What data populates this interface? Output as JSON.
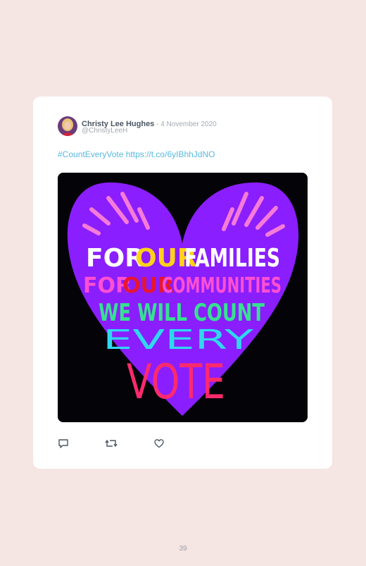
{
  "tweet": {
    "author_name": "Christy Lee Hughes",
    "separator": " - ",
    "date": "4 November 2020",
    "handle": "@ChristyLeeH",
    "hashtag": "#CountEveryVote",
    "link": "https://t.co/6yIBhhJdNO",
    "image": {
      "line1": [
        "FOR",
        "OUR",
        "FAMILIES"
      ],
      "line2": [
        "FOR",
        "OUR",
        "COMMUNITIES"
      ],
      "line3": "WE WILL COUNT",
      "line4": "EVERY",
      "line5": "VOTE",
      "colors": {
        "heart": "#8a1eff",
        "background": "#040408",
        "white_text": "#ffffff",
        "yellow_text": "#ffd21a",
        "pink_text": "#ff4fd2",
        "red_text": "#e8162e",
        "green_text": "#35e28f",
        "cyan_text": "#2fd8f0",
        "vote_text": "#ff2a6d",
        "rays": "#f67bd8"
      }
    },
    "actions": {
      "reply_icon": "reply-icon",
      "retweet_icon": "retweet-icon",
      "like_icon": "heart-icon"
    }
  },
  "page": {
    "number": "39"
  },
  "colors": {
    "page_background": "#f5e5e3",
    "card_background": "#ffffff",
    "link": "#59b9df",
    "muted": "#a3a9b1"
  }
}
